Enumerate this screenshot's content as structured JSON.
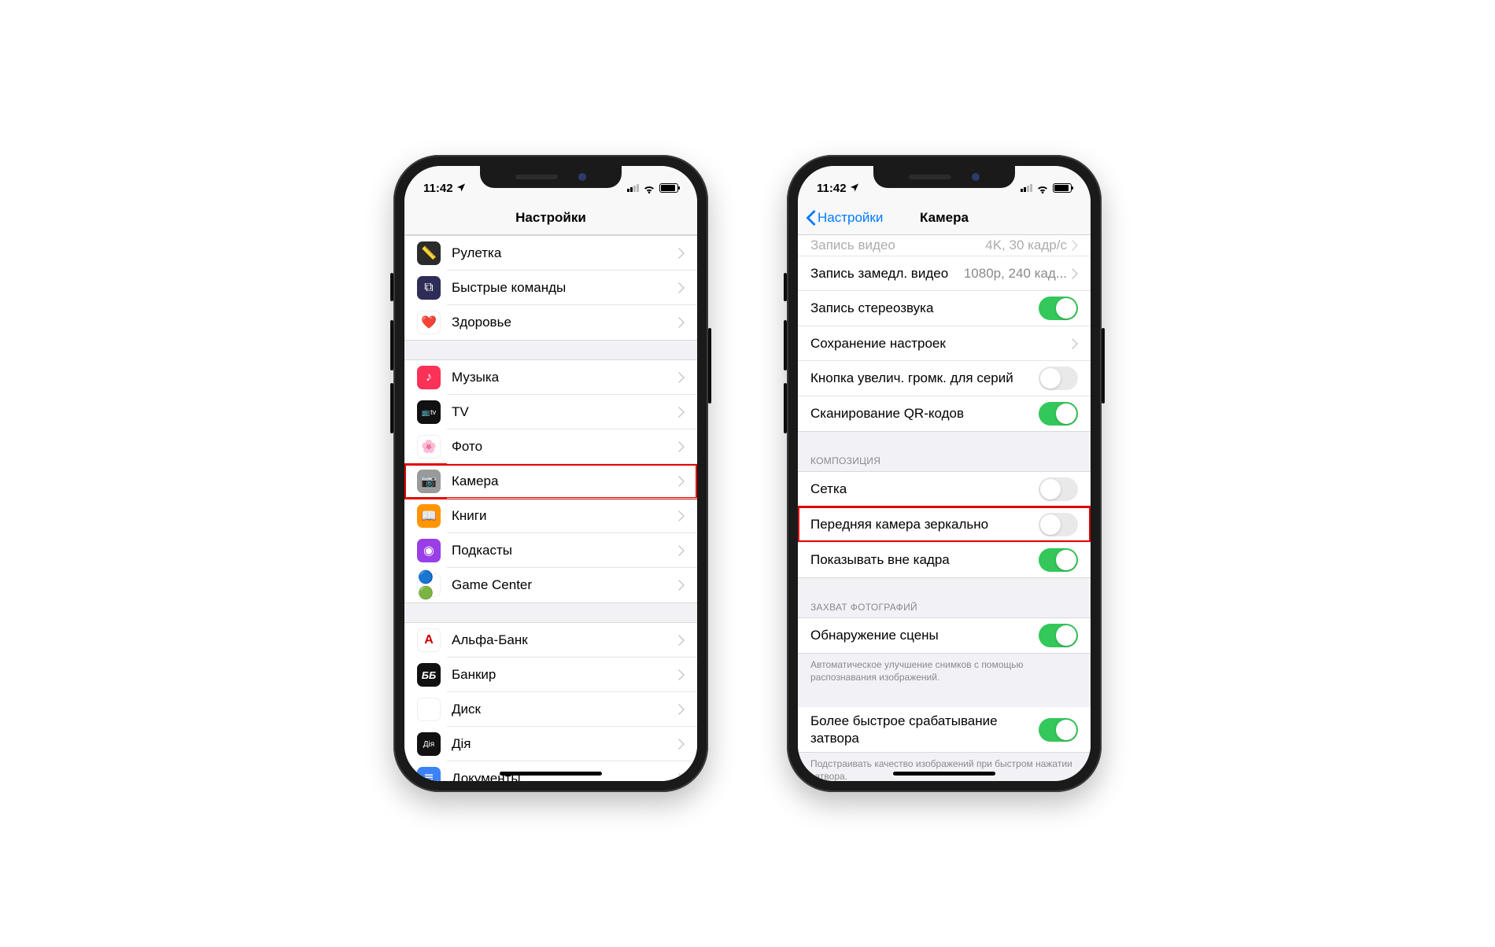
{
  "status": {
    "time": "11:42",
    "location_icon": "location-arrow"
  },
  "phone1": {
    "title": "Настройки",
    "groups": [
      {
        "items": [
          {
            "icon": "ruler-icon",
            "label": "Рулетка"
          },
          {
            "icon": "shortcuts-icon",
            "label": "Быстрые команды"
          },
          {
            "icon": "health-icon",
            "label": "Здоровье"
          }
        ]
      },
      {
        "items": [
          {
            "icon": "music-icon",
            "label": "Музыка"
          },
          {
            "icon": "tv-icon",
            "label": "TV"
          },
          {
            "icon": "photos-icon",
            "label": "Фото"
          },
          {
            "icon": "camera-icon",
            "label": "Камера",
            "highlight": true
          },
          {
            "icon": "books-icon",
            "label": "Книги"
          },
          {
            "icon": "podcasts-icon",
            "label": "Подкасты"
          },
          {
            "icon": "gamecenter-icon",
            "label": "Game Center"
          }
        ]
      },
      {
        "items": [
          {
            "icon": "alpha-icon",
            "label": "Альфа-Банк"
          },
          {
            "icon": "bb-icon",
            "label": "Банкир"
          },
          {
            "icon": "drive-icon",
            "label": "Диск"
          },
          {
            "icon": "dia-icon",
            "label": "Дія"
          },
          {
            "icon": "docs-icon",
            "label": "Документы"
          }
        ]
      }
    ]
  },
  "phone2": {
    "back": "Настройки",
    "title": "Камера",
    "sections": [
      {
        "header": null,
        "cutTop": true,
        "rows": [
          {
            "type": "link",
            "label": "Запись видео",
            "value": "4K, 30 кадр/с"
          },
          {
            "type": "link",
            "label": "Запись замедл. видео",
            "value": "1080p, 240 кад..."
          },
          {
            "type": "toggle",
            "label": "Запись стереозвука",
            "on": true
          },
          {
            "type": "link",
            "label": "Сохранение настроек",
            "value": ""
          },
          {
            "type": "toggle",
            "label": "Кнопка увелич. громк. для серий",
            "on": false
          },
          {
            "type": "toggle",
            "label": "Сканирование QR-кодов",
            "on": true
          }
        ],
        "footer": null
      },
      {
        "header": "КОМПОЗИЦИЯ",
        "rows": [
          {
            "type": "toggle",
            "label": "Сетка",
            "on": false
          },
          {
            "type": "toggle",
            "label": "Передняя камера зеркально",
            "on": false,
            "highlight": true
          },
          {
            "type": "toggle",
            "label": "Показывать вне кадра",
            "on": true
          }
        ],
        "footer": null
      },
      {
        "header": "ЗАХВАТ ФОТОГРАФИЙ",
        "rows": [
          {
            "type": "toggle",
            "label": "Обнаружение сцены",
            "on": true
          }
        ],
        "footer": "Автоматическое улучшение снимков с помощью распознавания изображений."
      },
      {
        "header": null,
        "rows": [
          {
            "type": "toggle",
            "label": "Более быстрое срабатывание затвора",
            "on": true,
            "multi": true
          }
        ],
        "footer": "Подстраивать качество изображений при быстром нажатии затвора."
      }
    ]
  }
}
